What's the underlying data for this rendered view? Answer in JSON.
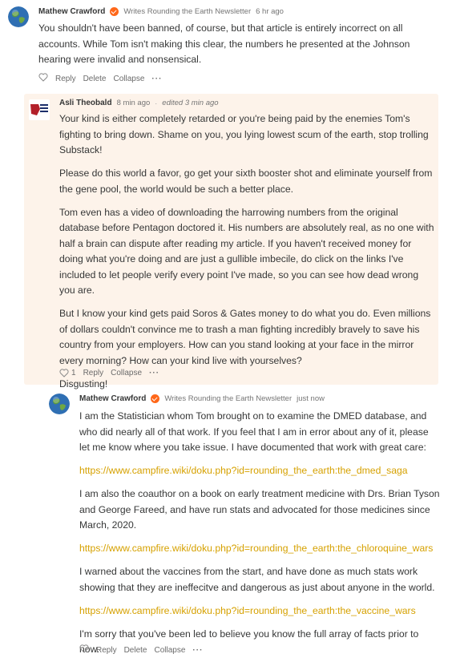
{
  "comment1": {
    "author": "Mathew Crawford",
    "writes": "Writes Rounding the Earth Newsletter",
    "time": "6 hr ago",
    "body": "You shouldn't have been banned, of course, but that article is entirely incorrect on all accounts. While Tom isn't making this clear, the numbers he presented at the Johnson hearing were invalid and nonsensical.",
    "actions": {
      "reply": "Reply",
      "delete": "Delete",
      "collapse": "Collapse"
    }
  },
  "comment2": {
    "author": "Asli Theobald",
    "time": "8 min ago",
    "edited": "edited 3 min ago",
    "paragraphs": [
      "Your kind is either completely retarded or you're being paid by the enemies Tom's fighting to bring down. Shame on you, you lying lowest scum of the earth, stop trolling Substack!",
      "Please do this world a favor, go get your sixth booster shot and eliminate yourself from the gene pool, the world would be such a better place.",
      "Tom even has a video of downloading the harrowing numbers from the original database before Pentagon doctored it. His numbers are absolutely real, as no one with half a brain can dispute after reading my article. If you haven't received money for doing what you're doing and are just a gullible imbecile, do click on the links I've included to let people verify every point I've made, so you can see how dead wrong you are.",
      "But I know your kind gets paid Soros & Gates money to do what you do. Even millions of dollars couldn't convince me to trash a man fighting incredibly bravely to save his country from your employers. How can you stand looking at your face in the mirror every morning? How can your kind live with yourselves?",
      "Disgusting!"
    ],
    "actions": {
      "likes": "1",
      "reply": "Reply",
      "collapse": "Collapse"
    }
  },
  "comment3": {
    "author": "Mathew Crawford",
    "writes": "Writes Rounding the Earth Newsletter",
    "time": "just now",
    "p1": "I am the Statistician whom Tom brought on to examine the DMED database, and who did nearly all of that work. If you feel that I am in error about any of it, please let me know where you take issue. I have documented that work with great care:",
    "link1": "https://www.campfire.wiki/doku.php?id=rounding_the_earth:the_dmed_saga",
    "p2": "I am also the coauthor on a book on early treatment medicine with Drs. Brian Tyson and George Fareed, and have run stats and advocated for those medicines since March, 2020.",
    "link2": "https://www.campfire.wiki/doku.php?id=rounding_the_earth:the_chloroquine_wars",
    "p3": "I warned about the vaccines from the start, and have done as much stats work showing that they are ineffecitve and dangerous as just about anyone in the world.",
    "link3": "https://www.campfire.wiki/doku.php?id=rounding_the_earth:the_vaccine_wars",
    "p4": "I'm sorry that you've been led to believe you know the full array of facts prior to now.",
    "actions": {
      "reply": "Reply",
      "delete": "Delete",
      "collapse": "Collapse"
    }
  },
  "colors": {
    "accent": "#ff6719",
    "link": "#d6a100",
    "highlight": "#fdf3ea"
  }
}
